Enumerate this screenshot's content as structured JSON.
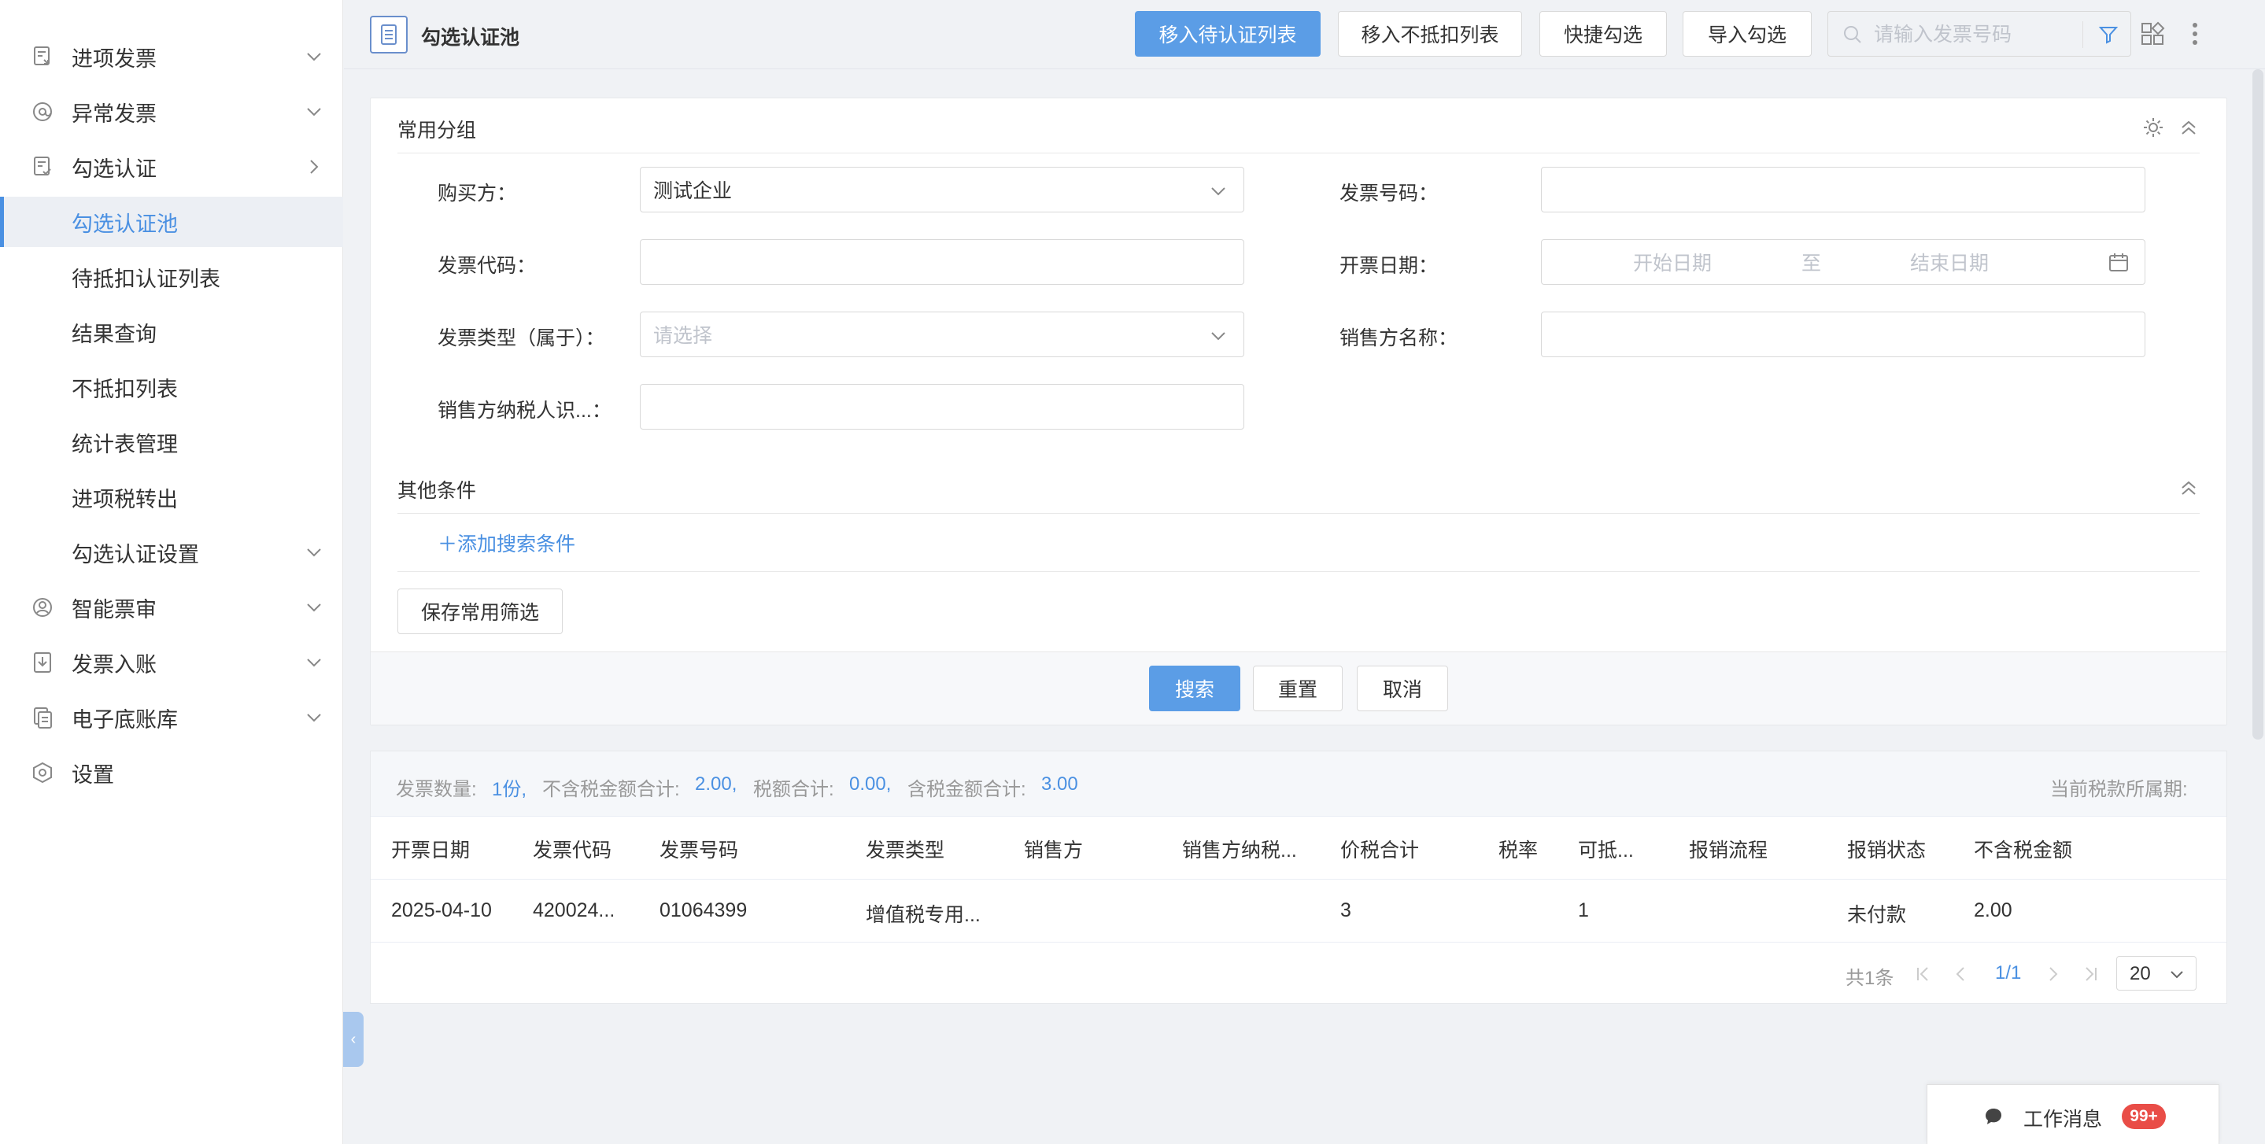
{
  "sidebar": {
    "items": [
      {
        "label": "进项发票",
        "icon": "invoice-in-icon",
        "chevron": "down"
      },
      {
        "label": "异常发票",
        "icon": "at-icon",
        "chevron": "down"
      },
      {
        "label": "勾选认证",
        "icon": "check-doc-icon",
        "chevron": "right"
      },
      {
        "label": "勾选认证池",
        "active": true
      },
      {
        "label": "待抵扣认证列表"
      },
      {
        "label": "结果查询"
      },
      {
        "label": "不抵扣列表"
      },
      {
        "label": "统计表管理"
      },
      {
        "label": "进项税转出"
      },
      {
        "label": "勾选认证设置",
        "chevron": "down"
      },
      {
        "label": "智能票审",
        "icon": "user-circle-icon",
        "chevron": "down"
      },
      {
        "label": "发票入账",
        "icon": "download-doc-icon",
        "chevron": "down"
      },
      {
        "label": "电子底账库",
        "icon": "copy-doc-icon",
        "chevron": "down"
      },
      {
        "label": "设置",
        "icon": "hexagon-settings-icon"
      }
    ]
  },
  "header": {
    "title": "勾选认证池",
    "buttons": {
      "move_pending": "移入待认证列表",
      "move_nondeduct": "移入不抵扣列表",
      "quick_select": "快捷勾选",
      "import_select": "导入勾选"
    },
    "search_placeholder": "请输入发票号码"
  },
  "filters": {
    "group_title": "常用分组",
    "buyer_label": "购买方：",
    "buyer_value": "测试企业",
    "invoice_no_label": "发票号码：",
    "invoice_no_value": "",
    "invoice_code_label": "发票代码：",
    "invoice_code_value": "",
    "issue_date_label": "开票日期：",
    "start_date_placeholder": "开始日期",
    "date_sep": "至",
    "end_date_placeholder": "结束日期",
    "invoice_type_label": "发票类型（属于）：",
    "invoice_type_placeholder": "请选择",
    "seller_name_label": "销售方名称：",
    "seller_name_value": "",
    "seller_taxid_label": "销售方纳税人识...：",
    "seller_taxid_value": "",
    "other_title": "其他条件",
    "add_condition": "＋添加搜索条件",
    "save_filter": "保存常用筛选",
    "search_btn": "搜索",
    "reset_btn": "重置",
    "cancel_btn": "取消"
  },
  "summary": {
    "count_label": "发票数量:",
    "count_value": "1份,",
    "amount_label": "不含税金额合计:",
    "amount_value": "2.00,",
    "tax_label": "税额合计:",
    "tax_value": "0.00,",
    "total_label": "含税金额合计:",
    "total_value": "3.00",
    "period_label": "当前税款所属期:"
  },
  "table": {
    "headers": [
      "开票日期",
      "发票代码",
      "发票号码",
      "发票类型",
      "销售方",
      "销售方纳税...",
      "价税合计",
      "税率",
      "可抵...",
      "报销流程",
      "报销状态",
      "不含税金额"
    ],
    "rows": [
      [
        "2025-04-10",
        "420024...",
        "01064399",
        "增值税专用...",
        "",
        "",
        "3",
        "",
        "1",
        "",
        "未付款",
        "2.00"
      ]
    ]
  },
  "pagination": {
    "total": "共1条",
    "page": "1/1",
    "page_size": "20"
  },
  "work_message": {
    "label": "工作消息",
    "badge": "99+"
  },
  "colors": {
    "accent": "#4a90e2",
    "primary_button": "#5b9de6",
    "badge": "#e94d47"
  }
}
